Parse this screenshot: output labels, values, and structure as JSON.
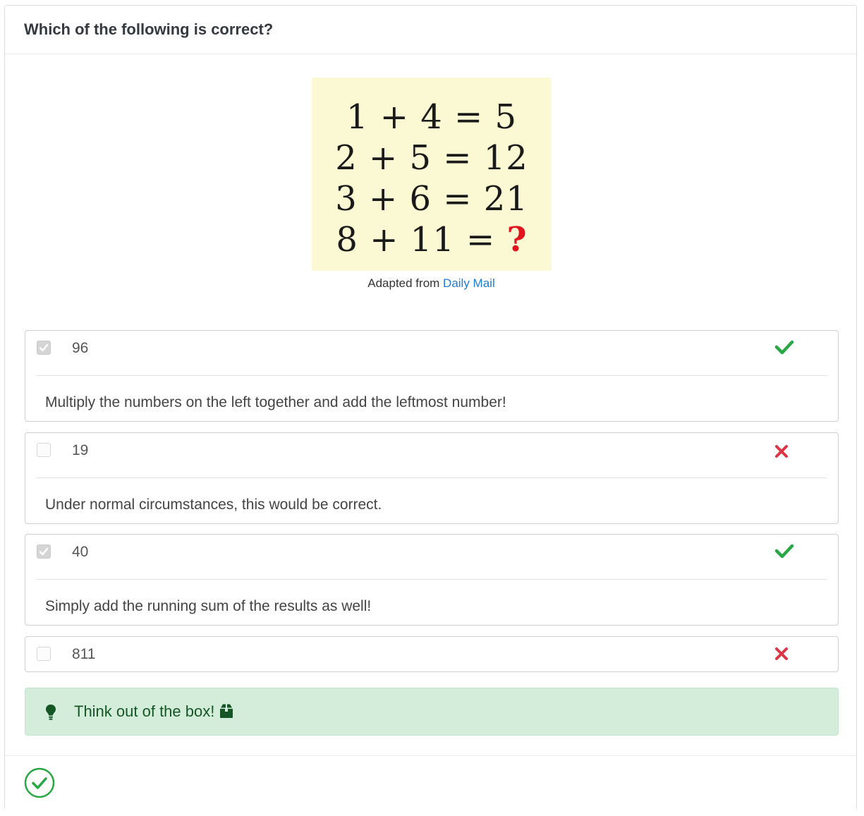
{
  "question": {
    "title": "Which of the following is correct?"
  },
  "puzzle": {
    "lines": [
      {
        "text": "1 + 4 = 5"
      },
      {
        "text": "2 + 5 = 12"
      },
      {
        "text": "3 + 6 = 21"
      },
      {
        "text": "8 + 11 = ",
        "mark": "?"
      }
    ],
    "background": "#fbf9d3",
    "mark_color": "#e0141c"
  },
  "caption": {
    "prefix": "Adapted from",
    "link": "Daily Mail"
  },
  "options": [
    {
      "value": "96",
      "checked": true,
      "result": "correct",
      "feedback": "Multiply the numbers on the left together and add the leftmost number!"
    },
    {
      "value": "19",
      "checked": false,
      "result": "incorrect",
      "feedback": "Under normal circumstances, this would be correct."
    },
    {
      "value": "40",
      "checked": true,
      "result": "correct",
      "feedback": "Simply add the running sum of the results as well!"
    },
    {
      "value": "811",
      "checked": false,
      "result": "incorrect",
      "feedback": ""
    }
  ],
  "hint": {
    "text": "Think out of the box!",
    "icons": [
      "lightbulb-icon",
      "box-icon"
    ]
  },
  "status": {
    "icon": "check-circle-icon",
    "color": "#28a745"
  },
  "colors": {
    "correct": "#28a745",
    "incorrect": "#dc3545",
    "link": "#1f7bd8",
    "hint_bg": "#d4eddb",
    "hint_text": "#155724"
  }
}
